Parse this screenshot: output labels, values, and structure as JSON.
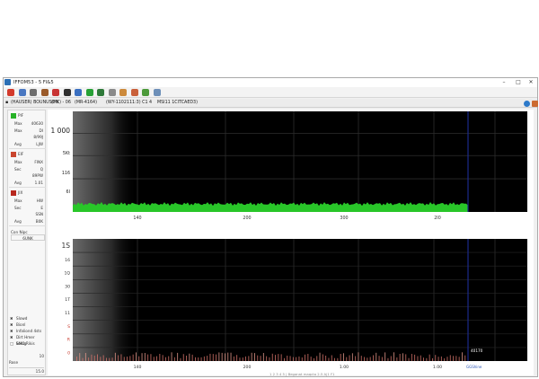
{
  "window": {
    "title": "IFFOM53 - 5 FI&5",
    "controls": {
      "minimize": "–",
      "maximize": "□",
      "close": "✕"
    }
  },
  "toolbar": {
    "icons": [
      {
        "name": "stop-icon",
        "color": "#d33a2c"
      },
      {
        "name": "tools-icon",
        "color": "#4a78c2"
      },
      {
        "name": "device-icon",
        "color": "#6d6d6d"
      },
      {
        "name": "drive-icon",
        "color": "#9a5a2a"
      },
      {
        "name": "disc-icon",
        "color": "#c83434"
      },
      {
        "name": "arrow-icon",
        "color": "#2f2f2f"
      },
      {
        "name": "pointer-icon",
        "color": "#3a6fc0"
      },
      {
        "name": "green-disc-icon",
        "color": "#27a136"
      },
      {
        "name": "save-icon",
        "color": "#2f7a3a"
      },
      {
        "name": "zoom-icon",
        "color": "#8a8a8a"
      },
      {
        "name": "search-icon",
        "color": "#cc8a3c"
      },
      {
        "name": "settings-icon",
        "color": "#c9603a"
      },
      {
        "name": "chart-icon",
        "color": "#4c9a3a"
      },
      {
        "name": "print-icon",
        "color": "#6d8fb8"
      }
    ]
  },
  "infobar": {
    "drive_label": "(HAUSER) BOUNUSON",
    "disc_field": "(MK) - 06",
    "media_field": "(MR-4164)",
    "type_field": "(WY-1102111:3) C1 4",
    "id_field": "MSI11 1CITCAED3)"
  },
  "sidebar": {
    "groups": [
      {
        "label": "PIF",
        "color": "#27b327",
        "rows": [
          {
            "k": "Max",
            "v": "40630"
          },
          {
            "k": "Max",
            "v": "DI"
          },
          {
            "k": "",
            "v": "8/99J"
          },
          {
            "k": "Avg",
            "v": "LJW"
          }
        ]
      },
      {
        "label": "EIF",
        "color": "#c9452e",
        "rows": [
          {
            "k": "Max",
            "v": "FINX"
          },
          {
            "k": "Sec",
            "v": "Q"
          },
          {
            "k": "",
            "v": "89PW"
          },
          {
            "k": "Avg",
            "v": "1.01"
          }
        ]
      },
      {
        "label": "JIX",
        "color": "#b8281f",
        "rows": [
          {
            "k": "Max",
            "v": "HW"
          },
          {
            "k": "Sec",
            "v": "E"
          },
          {
            "k": "",
            "v": "SSN"
          },
          {
            "k": "Avg",
            "v": "B0K"
          }
        ]
      }
    ],
    "footer_label": "Con Nipc",
    "footer_value": "6UNK",
    "checks": [
      {
        "mark": "✖",
        "label": "Slowd"
      },
      {
        "mark": "✖",
        "label": "Bionl"
      },
      {
        "mark": "✖",
        "label": "Infaliond 4sts"
      },
      {
        "mark": "✖",
        "label": "Dirt Hmer kolog"
      },
      {
        "mark": "□",
        "label": "SMO Rikis"
      }
    ],
    "speed_value": "10",
    "bottom_label": "Rose",
    "bottom_value": "15.0"
  },
  "chart_data": [
    {
      "type": "area",
      "ytick_labels": [
        "1 000",
        "5Kt",
        "116",
        "6I"
      ],
      "xtick_labels": [
        "140",
        "200",
        "300",
        "2I0"
      ],
      "series": [
        {
          "color": "#29c629",
          "level_fraction": 0.08
        }
      ],
      "marker": {
        "color": "#1c2a8a",
        "at": "end of scan"
      }
    },
    {
      "type": "bar",
      "ytick_labels": [
        "1S",
        "16",
        "1Q",
        "30",
        "1T",
        "11",
        "S",
        "R",
        "0"
      ],
      "xtick_labels": [
        "140",
        "200",
        "1.00",
        "1.00"
      ],
      "series": [
        {
          "color": "#d8746b"
        }
      ],
      "marker": {
        "color": "#1c2a8a",
        "label": "40170",
        "sub_label": "GGShine"
      }
    }
  ],
  "status_footer": {
    "left": "",
    "center": "1 2 3 4 5 | Beganat maqcta 2.5 A|1 F1"
  }
}
